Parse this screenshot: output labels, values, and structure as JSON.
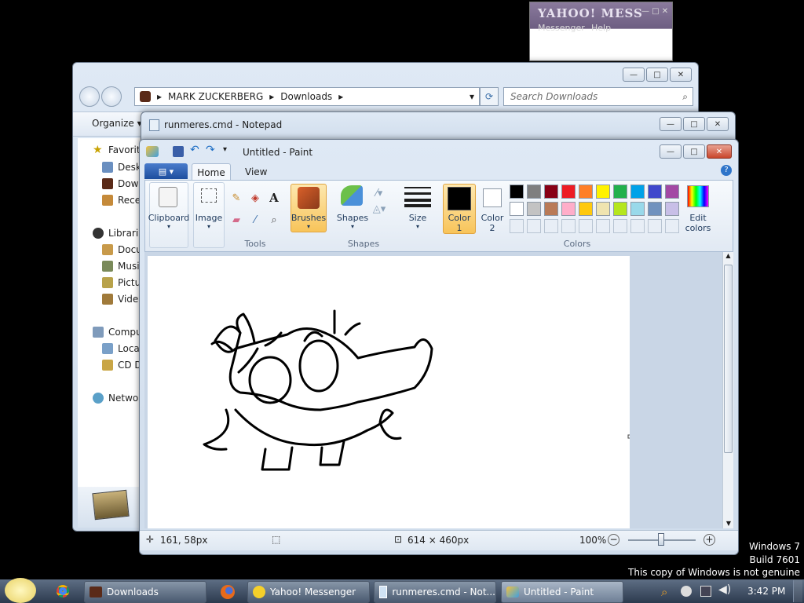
{
  "yahoo": {
    "logo": "YAHOO! MESS",
    "menu_messenger": "Messenger",
    "menu_help": "Help"
  },
  "explorer": {
    "breadcrumb": [
      "MARK ZUCKERBERG",
      "Downloads"
    ],
    "search_placeholder": "Search Downloads",
    "organize": "Organize",
    "sidebar": [
      {
        "label": "Favorit",
        "icon": "star-icon"
      },
      {
        "label": "Desk",
        "icon": "desktop-icon"
      },
      {
        "label": "Dow",
        "icon": "downloads-icon"
      },
      {
        "label": "Rece",
        "icon": "recent-places-icon"
      },
      {
        "label": "Librari",
        "icon": "libraries-icon"
      },
      {
        "label": "Docu",
        "icon": "documents-icon"
      },
      {
        "label": "Musi",
        "icon": "music-icon"
      },
      {
        "label": "Pictu",
        "icon": "pictures-icon"
      },
      {
        "label": "Vide",
        "icon": "videos-icon"
      },
      {
        "label": "Compu",
        "icon": "computer-icon"
      },
      {
        "label": "Loca",
        "icon": "local-disk-icon"
      },
      {
        "label": "CD D",
        "icon": "cd-drive-icon"
      },
      {
        "label": "Netwo",
        "icon": "network-icon"
      }
    ]
  },
  "notepad": {
    "title": "runmeres.cmd - Notepad"
  },
  "paint": {
    "title": "Untitled - Paint",
    "tabs": {
      "home": "Home",
      "view": "View"
    },
    "clipboard": "Clipboard",
    "image": "Image",
    "tools_label": "Tools",
    "brushes": "Brushes",
    "shapes": "Shapes",
    "shapes_group": "Shapes",
    "size": "Size",
    "color1": "Color",
    "color1_num": "1",
    "color2": "Color",
    "color2_num": "2",
    "colors_group": "Colors",
    "edit_colors_1": "Edit",
    "edit_colors_2": "colors",
    "palette_row1": [
      "#000000",
      "#7f7f7f",
      "#880015",
      "#ed1c24",
      "#ff7f27",
      "#fff200",
      "#22b14c",
      "#00a2e8",
      "#3f48cc",
      "#a349a4"
    ],
    "palette_row2": [
      "#ffffff",
      "#c3c3c3",
      "#b97a57",
      "#ffaec9",
      "#ffc90e",
      "#efe4b0",
      "#b5e61d",
      "#99d9ea",
      "#7092be",
      "#c8bfe7"
    ],
    "status": {
      "cursor": "161, 58px",
      "size": "614 × 460px",
      "zoom": "100%"
    }
  },
  "watermark": {
    "line1": "Windows 7",
    "line2": "Build 7601",
    "line3": "This copy of Windows is not genuine"
  },
  "taskbar": {
    "items": [
      {
        "label": "Downloads",
        "icon": "folder-icon"
      },
      {
        "label": "Yahoo! Messenger",
        "icon": "yahoo-smiley-icon"
      },
      {
        "label": "runmeres.cmd - Not...",
        "icon": "notepad-icon"
      },
      {
        "label": "Untitled - Paint",
        "icon": "paint-icon"
      }
    ],
    "clock": "3:42 PM"
  }
}
